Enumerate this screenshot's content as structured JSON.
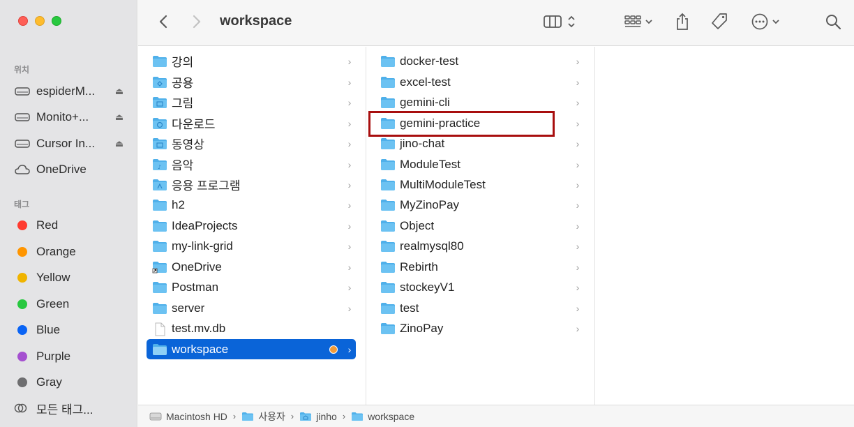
{
  "window": {
    "title": "workspace"
  },
  "sidebar": {
    "location_label": "위치",
    "locations": [
      {
        "label": "espiderM...",
        "icon": "drive-icon",
        "eject": true
      },
      {
        "label": "Monito+...",
        "icon": "drive-icon",
        "eject": true
      },
      {
        "label": "Cursor In...",
        "icon": "drive-icon",
        "eject": true
      },
      {
        "label": "OneDrive",
        "icon": "cloud-icon",
        "eject": false
      }
    ],
    "tags_label": "태그",
    "tags": [
      {
        "label": "Red",
        "color": "#ff3b30"
      },
      {
        "label": "Orange",
        "color": "#ff9500"
      },
      {
        "label": "Yellow",
        "color": "#f0b400"
      },
      {
        "label": "Green",
        "color": "#28c840"
      },
      {
        "label": "Blue",
        "color": "#0a64f5"
      },
      {
        "label": "Purple",
        "color": "#a550d0"
      },
      {
        "label": "Gray",
        "color": "#6e6e70"
      }
    ],
    "all_tags_label": "모든 태그..."
  },
  "column1": {
    "items": [
      {
        "label": "강의",
        "icon": "folder-icon",
        "chevron": true
      },
      {
        "label": "공용",
        "icon": "shared-folder-icon",
        "chevron": true
      },
      {
        "label": "그림",
        "icon": "pictures-folder-icon",
        "chevron": true
      },
      {
        "label": "다운로드",
        "icon": "downloads-folder-icon",
        "chevron": true
      },
      {
        "label": "동영상",
        "icon": "movies-folder-icon",
        "chevron": true
      },
      {
        "label": "음악",
        "icon": "music-folder-icon",
        "chevron": true
      },
      {
        "label": "응용 프로그램",
        "icon": "applications-folder-icon",
        "chevron": true
      },
      {
        "label": "h2",
        "icon": "folder-icon",
        "chevron": true
      },
      {
        "label": "IdeaProjects",
        "icon": "folder-icon",
        "chevron": true
      },
      {
        "label": "my-link-grid",
        "icon": "folder-icon",
        "chevron": true
      },
      {
        "label": "OneDrive",
        "icon": "alias-folder-icon",
        "chevron": true
      },
      {
        "label": "Postman",
        "icon": "folder-icon",
        "chevron": true
      },
      {
        "label": "server",
        "icon": "folder-icon",
        "chevron": true
      },
      {
        "label": "test.mv.db",
        "icon": "document-icon",
        "chevron": false
      },
      {
        "label": "workspace",
        "icon": "folder-icon",
        "chevron": true,
        "selected": true,
        "tag_color": "#f29b38"
      }
    ]
  },
  "column2": {
    "items": [
      {
        "label": "docker-test"
      },
      {
        "label": "excel-test"
      },
      {
        "label": "gemini-cli"
      },
      {
        "label": "gemini-practice",
        "highlighted": true
      },
      {
        "label": "jino-chat"
      },
      {
        "label": "ModuleTest"
      },
      {
        "label": "MultiModuleTest"
      },
      {
        "label": "MyZinoPay"
      },
      {
        "label": "Object"
      },
      {
        "label": "realmysql80"
      },
      {
        "label": "Rebirth"
      },
      {
        "label": "stockeyV1"
      },
      {
        "label": "test"
      },
      {
        "label": "ZinoPay"
      }
    ]
  },
  "pathbar": {
    "segments": [
      {
        "label": "Macintosh HD",
        "icon": "hard-drive-icon"
      },
      {
        "label": "사용자",
        "icon": "folder-icon"
      },
      {
        "label": "jinho",
        "icon": "home-folder-icon"
      },
      {
        "label": "workspace",
        "icon": "folder-icon"
      }
    ]
  },
  "colors": {
    "selection": "#0a64d8",
    "folder": "#4fb0ea",
    "highlight_box": "#a80e0e"
  }
}
